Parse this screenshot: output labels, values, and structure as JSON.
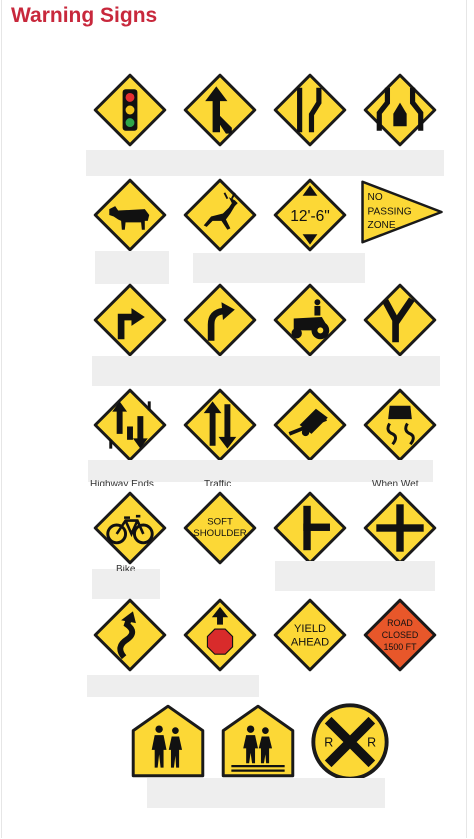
{
  "page": {
    "title": "Warning Signs"
  },
  "colors": {
    "title": "#c8283c",
    "sign_yellow": "#fcd836",
    "sign_orange": "#e8572a",
    "outline": "#1a1a1a",
    "answer_box": "#eeeeee"
  },
  "signs": {
    "no_passing": {
      "line1": "NO",
      "line2": "PASSING",
      "line3": "ZONE"
    },
    "low_clearance": {
      "text": "12'-6\""
    },
    "soft_shoulder": {
      "line1": "SOFT",
      "line2": "SHOULDER"
    },
    "yield_ahead": {
      "line1": "YIELD",
      "line2": "AHEAD"
    },
    "road_closed": {
      "line1": "ROAD",
      "line2": "CLOSED",
      "line3": "1500 FT"
    },
    "railroad": {
      "left": "R",
      "right": "R"
    }
  },
  "partial_labels": {
    "highway_ends": "Highway Ends",
    "traffic": "Traffic",
    "when_wet": "When Wet",
    "bike": "Bike"
  }
}
